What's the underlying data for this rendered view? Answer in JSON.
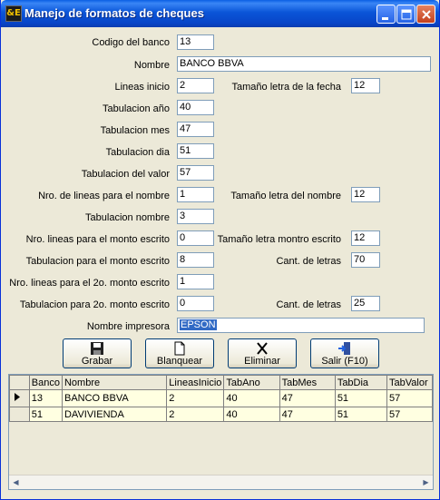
{
  "window": {
    "title": "Manejo de formatos de cheques",
    "icon_text": "&E"
  },
  "form": {
    "codigo": {
      "label": "Codigo del banco",
      "value": "13"
    },
    "nombre": {
      "label": "Nombre",
      "value": "BANCO BBVA"
    },
    "lineas_inicio": {
      "label": "Lineas inicio",
      "value": "2"
    },
    "tam_fecha": {
      "label": "Tamaño letra de la fecha",
      "value": "12"
    },
    "tab_anio": {
      "label": "Tabulacion año",
      "value": "40"
    },
    "tab_mes": {
      "label": "Tabulacion mes",
      "value": "47"
    },
    "tab_dia": {
      "label": "Tabulacion dia",
      "value": "51"
    },
    "tab_valor": {
      "label": "Tabulacion del valor",
      "value": "57"
    },
    "lineas_nombre": {
      "label": "Nro. de lineas para el nombre",
      "value": "1"
    },
    "tam_nombre": {
      "label": "Tamaño letra del nombre",
      "value": "12"
    },
    "tab_nombre": {
      "label": "Tabulacion nombre",
      "value": "3"
    },
    "lineas_monto": {
      "label": "Nro. lineas para el monto escrito",
      "value": "0"
    },
    "tam_monto": {
      "label": "Tamaño letra montro escrito",
      "value": "12"
    },
    "tab_monto": {
      "label": "Tabulacion para el monto escrito",
      "value": "8"
    },
    "cant_letras1": {
      "label": "Cant. de letras",
      "value": "70"
    },
    "lineas_monto2": {
      "label": "Nro. lineas para el 2o. monto escrito",
      "value": "1"
    },
    "tab_monto2": {
      "label": "Tabulacion para 2o. monto escrito",
      "value": "0"
    },
    "cant_letras2": {
      "label": "Cant. de letras",
      "value": "25"
    },
    "impresora": {
      "label": "Nombre impresora",
      "value": "EPSON"
    }
  },
  "buttons": {
    "grabar": "Grabar",
    "blanquear": "Blanquear",
    "eliminar": "Eliminar",
    "salir": "Salir (F10)"
  },
  "grid": {
    "columns": [
      "Banco",
      "Nombre",
      "LineasInicio",
      "TabAno",
      "TabMes",
      "TabDia",
      "TabValor"
    ],
    "rows": [
      [
        "13",
        "BANCO BBVA",
        "2",
        "40",
        "47",
        "51",
        "57"
      ],
      [
        "51",
        "DAVIVIENDA",
        "2",
        "40",
        "47",
        "51",
        "57"
      ]
    ]
  }
}
